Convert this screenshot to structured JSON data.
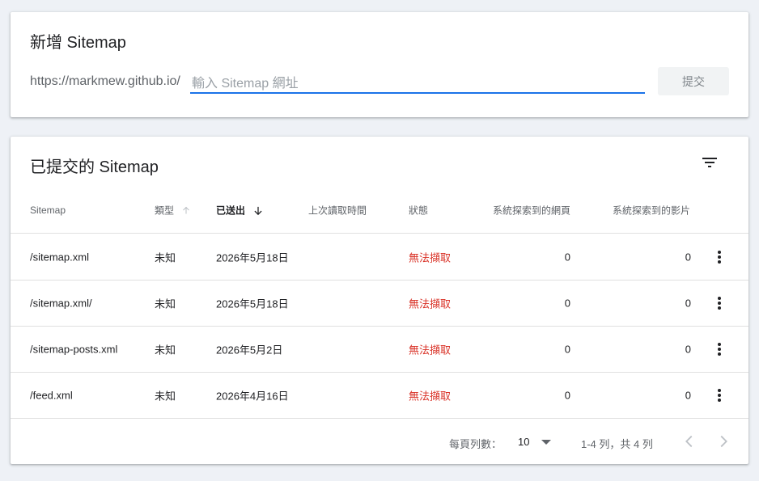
{
  "add_card": {
    "title": "新增 Sitemap",
    "url_prefix": "https://markmew.github.io/",
    "input_placeholder": "輸入 Sitemap 網址",
    "input_value": "",
    "submit_label": "提交"
  },
  "list_card": {
    "title": "已提交的 Sitemap",
    "filter_icon": "filter-icon",
    "columns": {
      "sitemap": "Sitemap",
      "type": "類型",
      "sent": "已送出",
      "last_read": "上次讀取時間",
      "status": "狀態",
      "pages": "系統探索到的網頁",
      "videos": "系統探索到的影片"
    },
    "sort": {
      "column": "sent",
      "direction": "descending"
    },
    "rows": [
      {
        "sitemap": "/sitemap.xml",
        "type": "未知",
        "sent": "2026年5月18日",
        "last_read": "",
        "status": "無法擷取",
        "pages": "0",
        "videos": "0"
      },
      {
        "sitemap": "/sitemap.xml/",
        "type": "未知",
        "sent": "2026年5月18日",
        "last_read": "",
        "status": "無法擷取",
        "pages": "0",
        "videos": "0"
      },
      {
        "sitemap": "/sitemap-posts.xml",
        "type": "未知",
        "sent": "2026年5月2日",
        "last_read": "",
        "status": "無法擷取",
        "pages": "0",
        "videos": "0"
      },
      {
        "sitemap": "/feed.xml",
        "type": "未知",
        "sent": "2026年4月16日",
        "last_read": "",
        "status": "無法擷取",
        "pages": "0",
        "videos": "0"
      }
    ],
    "pager": {
      "rows_per_page_label": "每頁列數：",
      "rows_per_page": "10",
      "range": "1-4 列，共 4 列"
    }
  },
  "colors": {
    "accent": "#1a73e8",
    "error": "#d93025",
    "background": "#eef1f6"
  }
}
